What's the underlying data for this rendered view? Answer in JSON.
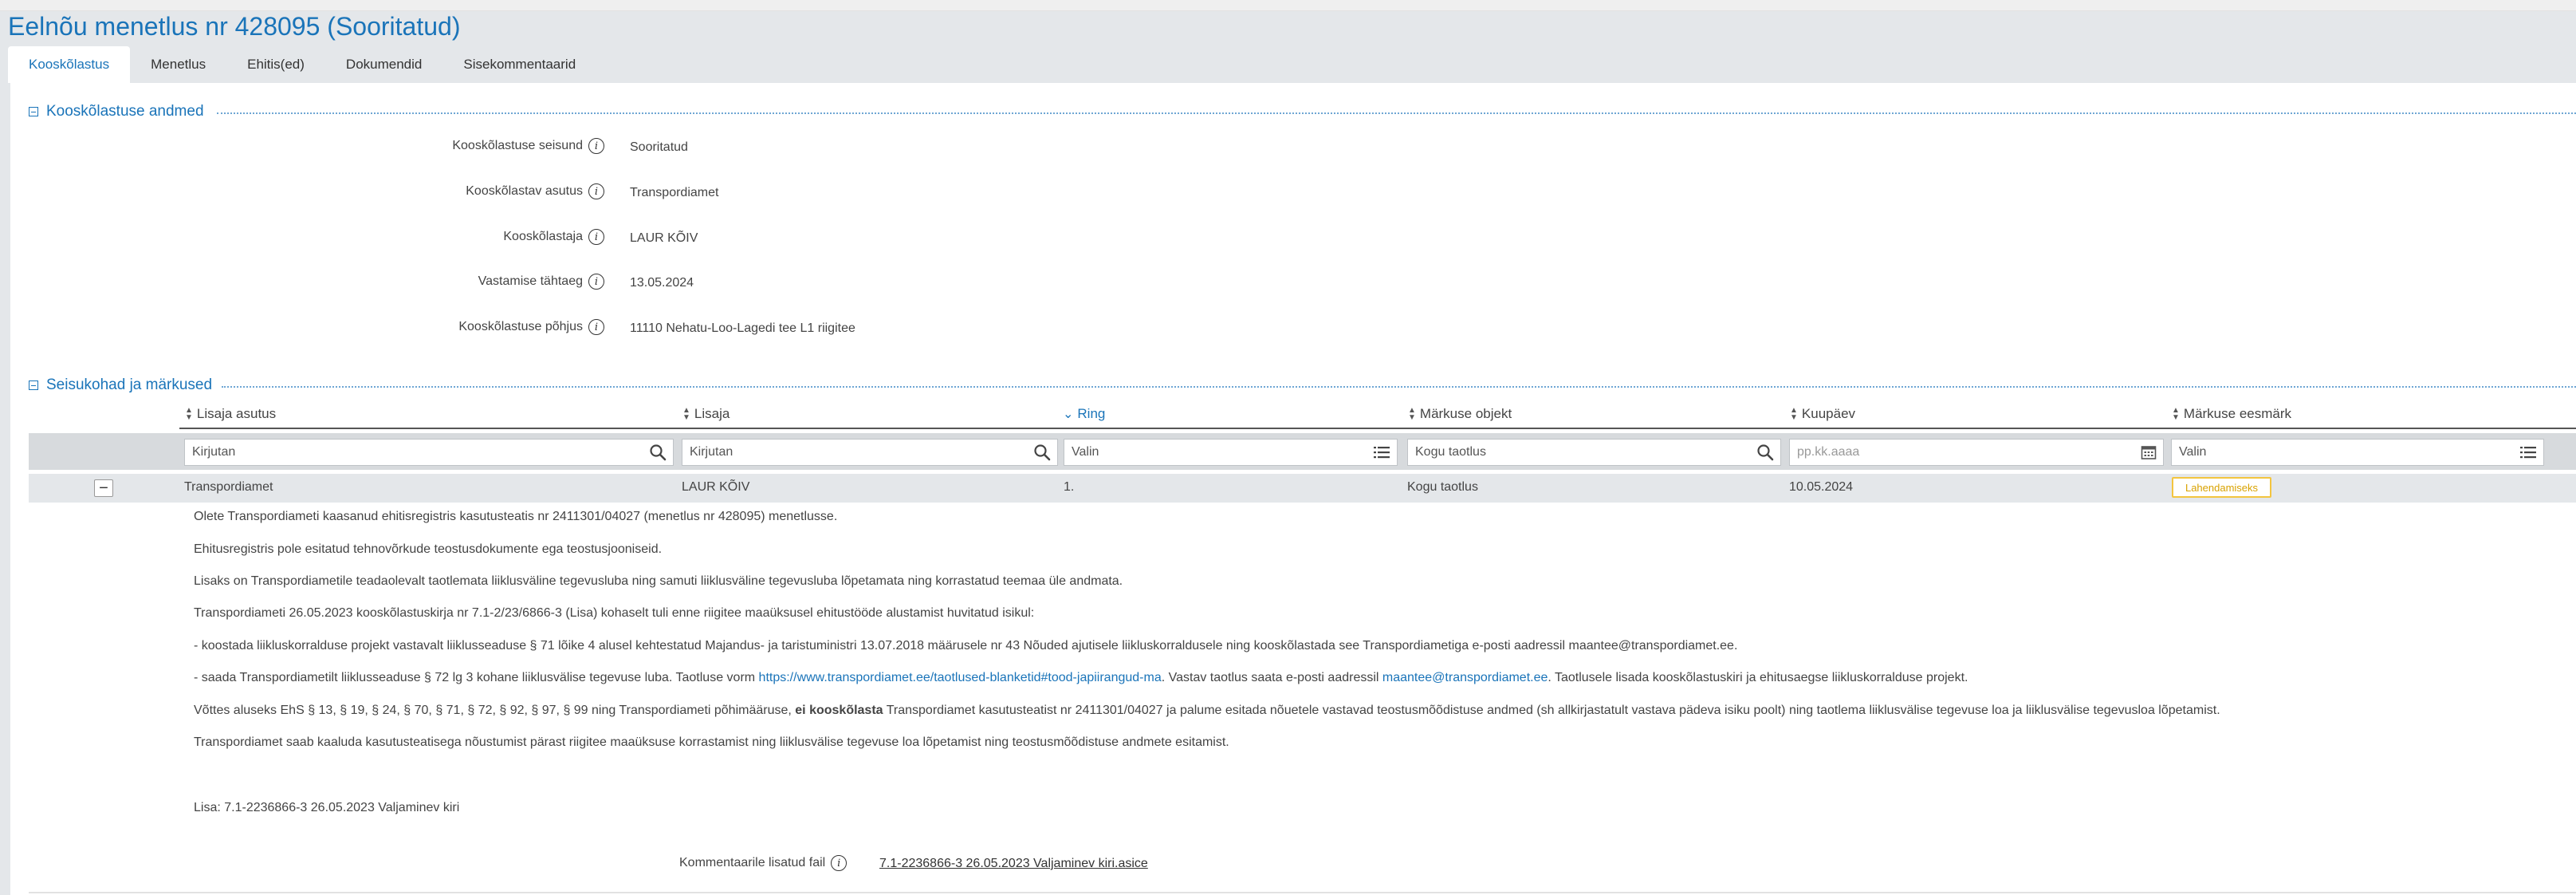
{
  "page": {
    "title": "Eelnõu menetlus nr 428095 (Sooritatud)"
  },
  "tabs": [
    {
      "label": "Kooskõlastus",
      "active": true
    },
    {
      "label": "Menetlus"
    },
    {
      "label": "Ehitis(ed)"
    },
    {
      "label": "Dokumendid"
    },
    {
      "label": "Sisekommentaarid"
    }
  ],
  "section1": {
    "title": "Kooskõlastuse andmed",
    "fields": [
      {
        "label": "Kooskõlastuse seisund",
        "value": "Sooritatud"
      },
      {
        "label": "Kooskõlastav asutus",
        "value": "Transpordiamet"
      },
      {
        "label": "Kooskõlastaja",
        "value": "LAUR KÕIV"
      },
      {
        "label": "Vastamise tähtaeg",
        "value": "13.05.2024"
      },
      {
        "label": "Kooskõlastuse põhjus",
        "value": "11110 Nehatu-Loo-Lagedi tee L1 riigitee"
      }
    ]
  },
  "section2": {
    "title": "Seisukohad ja märkused",
    "columns": [
      {
        "label": "Lisaja asutus"
      },
      {
        "label": "Lisaja"
      },
      {
        "label": "Ring",
        "sorted": true
      },
      {
        "label": "Märkuse objekt"
      },
      {
        "label": "Kuupäev"
      },
      {
        "label": "Märkuse eesmärk"
      }
    ],
    "filters": [
      {
        "value": "Kirjutan",
        "icon": "search-icon"
      },
      {
        "value": "Kirjutan",
        "icon": "search-icon"
      },
      {
        "value": "Valin",
        "icon": "list-icon"
      },
      {
        "value": "Kogu taotlus",
        "icon": "search-icon"
      },
      {
        "placeholder": "pp.kk.aaaa",
        "icon": "calendar-icon"
      },
      {
        "value": "Valin",
        "icon": "list-icon"
      }
    ],
    "row": {
      "toggle": "−",
      "lisaja_asutus": "Transpordiamet",
      "lisaja": "LAUR KÕIV",
      "ring": "1.",
      "objekt": "Kogu taotlus",
      "kuupaev": "10.05.2024",
      "eesmark": "Lahendamiseks"
    },
    "comment": {
      "p1": "Olete Transpordiameti kaasanud ehitisregistris kasutusteatis nr 2411301/04027 (menetlus nr 428095) menetlusse.",
      "p2": "Ehitusregistris pole esitatud tehnovõrkude teostusdokumente ega teostusjooniseid.",
      "p3": "Lisaks on Transpordiametile teadaolevalt taotlemata liiklusväline tegevusluba ning samuti liiklusväline tegevusluba lõpetamata ning korrastatud teemaa üle andmata.",
      "p4": "Transpordiameti 26.05.2023 kooskõlastuskirja nr 7.1-2/23/6866-3 (Lisa) kohaselt tuli enne riigitee maaüksusel ehitustööde alustamist huvitatud isikul:",
      "p5": "- koostada liikluskorralduse projekt vastavalt liiklusseaduse § 71 lõike 4 alusel kehtestatud Majandus- ja taristuministri 13.07.2018 määrusele nr 43 Nõuded ajutisele liikluskorraldusele ning kooskõlastada see Transpordiametiga e-posti aadressil maantee@transpordiamet.ee.",
      "p6_pre": "- saada Transpordiametilt liiklusseaduse § 72 lg 3 kohane liiklusvälise tegevuse luba. Taotluse vorm ",
      "p6_link": "https://www.transpordiamet.ee/taotlused-blanketid#tood-japiirangud-ma",
      "p6_mid": ". Vastav taotlus saata e-posti aadressil ",
      "p6_email": "maantee@transpordiamet.ee",
      "p6_post": ". Taotlusele lisada kooskõlastuskiri ja ehitusaegse liikluskorralduse projekt.",
      "p7_pre": "Võttes aluseks EhS § 13, § 19, § 24, § 70, § 71, § 72, § 92, § 97, § 99 ning Transpordiameti põhimääruse, ",
      "p7_bold": "ei kooskõlasta",
      "p7_post": " Transpordiamet kasutusteatist nr 2411301/04027 ja palume esitada nõuetele vastavad teostusmõõdistuse andmed (sh allkirjastatult vastava pädeva isiku poolt) ning taotlema liiklusvälise tegevuse loa ja liiklusvälise tegevusloa lõpetamist.",
      "p8": "Transpordiamet saab kaaluda kasutusteatisega nõustumist pärast riigitee maaüksuse korrastamist ning liiklusvälise tegevuse loa lõpetamist ning teostusmõõdistuse andmete esitamist.",
      "lisa": "Lisa: 7.1-2236866-3 26.05.2023 Valjaminev kiri"
    },
    "attachment": {
      "label": "Kommentaarile lisatud fail",
      "file": "7.1-2236866-3 26.05.2023 Valjaminev kiri.asice"
    }
  },
  "colors": {
    "accent": "#1a74b9",
    "badge": "#f3c53f",
    "header_bg": "#e4e7ea"
  }
}
